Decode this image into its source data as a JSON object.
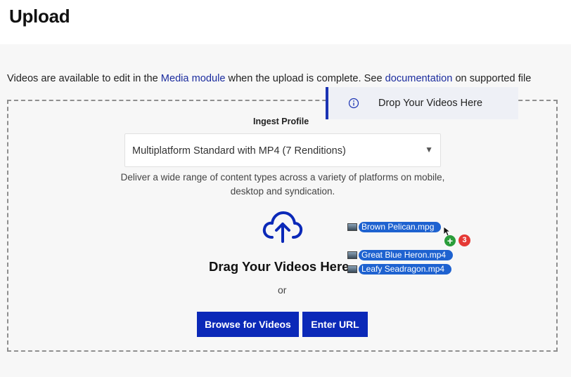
{
  "page": {
    "title": "Upload"
  },
  "intro": {
    "prefix": "Videos are available to edit in the ",
    "media_link": "Media module",
    "middle": " when the upload is complete. See ",
    "doc_link": "documentation",
    "suffix": " on supported file"
  },
  "ingest": {
    "label": "Ingest Profile",
    "selected": "Multiplatform Standard with MP4 (7 Renditions)",
    "description": "Deliver a wide range of content types across a variety of platforms on mobile, desktop and syndication."
  },
  "dropzone": {
    "heading": "Drag Your Videos Here",
    "or": "or",
    "browse_label": "Browse for Videos",
    "url_label": "Enter URL"
  },
  "toast": {
    "text": "Drop Your Videos Here"
  },
  "drag": {
    "files": [
      "Brown Pelican.mpg",
      "Great Blue Heron.mp4",
      "Leafy Seadragon.mp4"
    ],
    "add_symbol": "+",
    "count": "3"
  },
  "colors": {
    "accent": "#0b29b8",
    "link": "#1b2c9e",
    "chip": "#1e62d0",
    "badge_red": "#e53935",
    "badge_green": "#2a9d3a"
  },
  "icons": {
    "upload": "cloud-upload-icon",
    "info": "info-icon",
    "dropdown": "chevron-down-icon"
  }
}
